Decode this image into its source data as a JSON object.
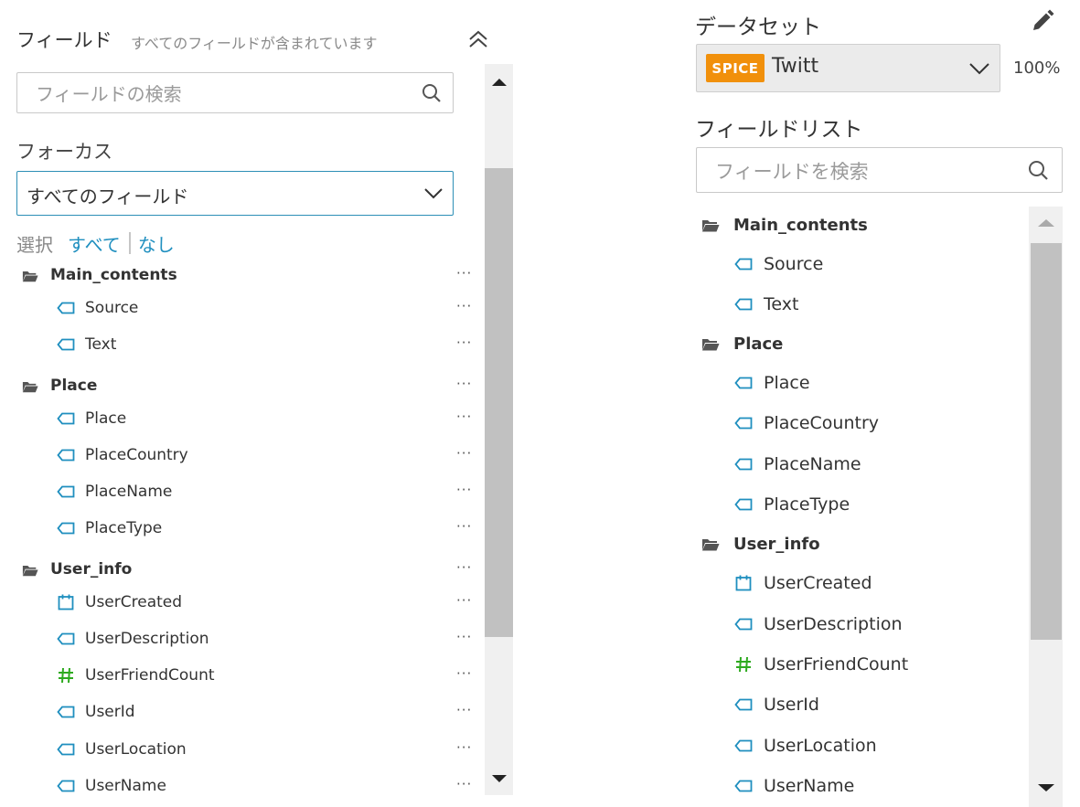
{
  "left_panel": {
    "title": "フィールド",
    "subtitle": "すべてのフィールドが含まれています",
    "search_placeholder": "フィールドの検索",
    "focus_label": "フォーカス",
    "focus_value": "すべてのフィールド",
    "select_label": "選択",
    "select_all": "すべて",
    "select_none": "なし",
    "more_label": "···"
  },
  "right_panel": {
    "dataset_title": "データセット",
    "badge": "SPICE",
    "dataset_name": "Twitt",
    "dataset_percent": "100%",
    "fieldlist_title": "フィールドリスト",
    "search_placeholder": "フィールドを検索"
  },
  "groups": [
    {
      "name": "Main_contents",
      "fields": [
        {
          "name": "Source",
          "type": "dimension",
          "icon": "tag-icon"
        },
        {
          "name": "Text",
          "type": "dimension",
          "icon": "tag-icon"
        }
      ]
    },
    {
      "name": "Place",
      "fields": [
        {
          "name": "Place",
          "type": "dimension",
          "icon": "tag-icon"
        },
        {
          "name": "PlaceCountry",
          "type": "dimension",
          "icon": "tag-icon"
        },
        {
          "name": "PlaceName",
          "type": "dimension",
          "icon": "tag-icon"
        },
        {
          "name": "PlaceType",
          "type": "dimension",
          "icon": "tag-icon"
        }
      ]
    },
    {
      "name": "User_info",
      "fields": [
        {
          "name": "UserCreated",
          "type": "date",
          "icon": "calendar-icon"
        },
        {
          "name": "UserDescription",
          "type": "dimension",
          "icon": "tag-icon"
        },
        {
          "name": "UserFriendCount",
          "type": "measure",
          "icon": "hash-icon"
        },
        {
          "name": "UserId",
          "type": "dimension",
          "icon": "tag-icon"
        },
        {
          "name": "UserLocation",
          "type": "dimension",
          "icon": "tag-icon"
        },
        {
          "name": "UserName",
          "type": "dimension",
          "icon": "tag-icon"
        }
      ]
    }
  ],
  "colors": {
    "link": "#1f8fbf",
    "dimension_icon": "#1f8fbf",
    "measure_icon": "#2eaa1f",
    "spice_badge": "#f1900b",
    "focus_border": "#2d8fb6"
  }
}
